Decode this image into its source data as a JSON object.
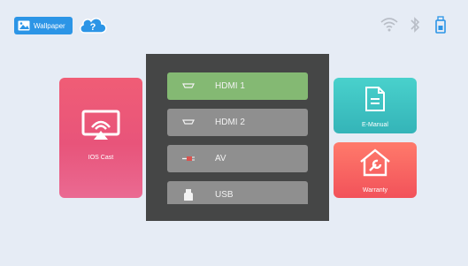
{
  "topbar": {
    "wallpaper_label": "Wallpaper",
    "wallpaper_icon": "image-icon",
    "help_icon": "cast-help-icon",
    "status_icons": [
      "wifi-icon",
      "bluetooth-icon",
      "usb-drive-icon"
    ]
  },
  "cards": {
    "ios_cast": {
      "label": "IOS Cast",
      "icon": "screen-mirroring-icon",
      "color": "#ee5b7a"
    },
    "e_manual": {
      "label": "E-Manual",
      "icon": "document-icon",
      "color": "#3cc2c0"
    },
    "warranty": {
      "label": "Warranty",
      "icon": "house-wrench-icon",
      "color": "#f4635f"
    }
  },
  "source_menu": {
    "items": [
      {
        "label": "HDMI 1",
        "icon": "hdmi-icon",
        "active": true
      },
      {
        "label": "HDMI 2",
        "icon": "hdmi-icon",
        "active": false
      },
      {
        "label": "AV",
        "icon": "av-plug-icon",
        "active": false
      },
      {
        "label": "USB",
        "icon": "usb-stick-icon",
        "active": false
      }
    ],
    "active_color": "#84b973"
  }
}
